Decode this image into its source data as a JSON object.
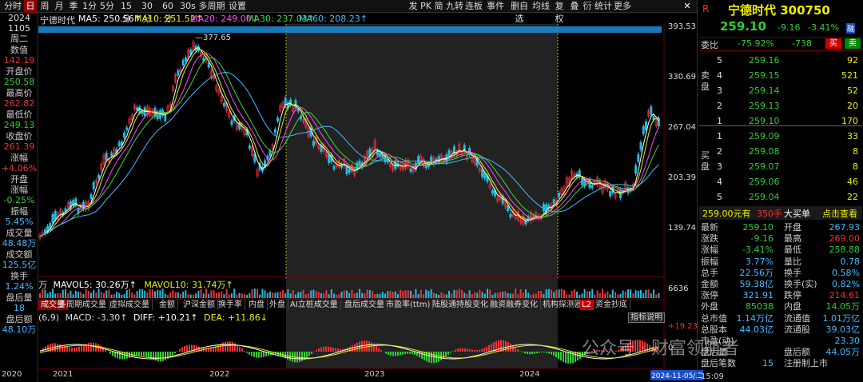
{
  "left": {
    "time_label": "时间",
    "year": "2024",
    "date": "1105",
    "weekday": "周二",
    "value_label": "数值",
    "value": "142.19",
    "open_label": "开盘价",
    "open": "250.58",
    "high_label": "最高价",
    "high": "262.82",
    "low_label": "最低价",
    "low": "249.13",
    "close_label": "收盘价",
    "close": "261.39",
    "chg_label": "涨幅",
    "chg": "+4.06%",
    "openchg_label1": "开盘",
    "openchg_label2": "涨幅",
    "openchg": "-0.25%",
    "amp_label": "振幅",
    "amp": "5.45%",
    "vol_label": "成交量",
    "vol": "48.48万",
    "amt_label": "成交额",
    "amt": "125.5亿",
    "turn_label": "换手",
    "turn": "1.24%",
    "after_label": "盘后量",
    "after": "18",
    "after_amt_label": "盘后额",
    "after_amt": "48.10万"
  },
  "toolbar": {
    "left": [
      "分时",
      "日",
      "周",
      "月",
      "季",
      "1分",
      "5分",
      "15分",
      "30分",
      "60分",
      "30s",
      "多周期",
      "设置"
    ],
    "selected": "日",
    "right": [
      "发",
      "PK",
      "简",
      "九转",
      "连板",
      "事件",
      "删自选",
      "均线",
      "复权",
      "叠",
      "衍",
      "统计",
      "更多"
    ]
  },
  "ma_legend": {
    "stock": "宁德时代",
    "ma5": "MA5: 250.56↑",
    "ma10": "MA10: 251.52↑",
    "ma20": "MA20: 249.00↓",
    "ma30": "MA30: 237.03↑",
    "ma60": "MA60: 208.23↑"
  },
  "price_axis": [
    "393.53",
    "330.69",
    "267.04",
    "203.39",
    "139.74"
  ],
  "peak_label": "377.65",
  "volume_legend": {
    "prefix": "万",
    "mavol5": "MAVOL5: 30.26万↑",
    "mavol10": "MAVOL10: 31.74万↑",
    "axis": "6636"
  },
  "ind_tabs": [
    "成交量",
    "多周期成交量",
    "虚拟成交量",
    "金额",
    "沪深金额",
    "换手率",
    "内盘",
    "外盘",
    "AI立桩成交量",
    "盘后成交量",
    "市盈率(ttm)",
    "陆股通持股变化",
    "融资融券变化",
    "机构探测器",
    "资金抄底"
  ],
  "ind_tab_badge": "L2",
  "macd": {
    "params": "(6,9)",
    "macd": "MACD: -3.30↑",
    "dif": "DIFF: +10.21↑",
    "dea": "DEA: +11.86↓",
    "axis_top": "19.23",
    "axis_zero": "0",
    "btn": "指标说明"
  },
  "years": [
    "2020",
    "2021",
    "2022",
    "2023",
    "2024"
  ],
  "cur_date": "2024-11-05/二",
  "watermark": "公众号 · 财富领航者",
  "right": {
    "name": "宁德时代",
    "code": "300750",
    "price": "259.10",
    "chg": "-9.16",
    "pct": "-3.41%",
    "tag": "融",
    "wb_label": "委比",
    "wb": "-75.92%",
    "wc": "-738",
    "buy_btn": "买",
    "sell_btn": "卖",
    "sell_side": "卖盘",
    "buy_side": "买盘",
    "asks": [
      {
        "lv": "5",
        "p": "259.16",
        "v": "92"
      },
      {
        "lv": "4",
        "p": "259.15",
        "v": "521"
      },
      {
        "lv": "3",
        "p": "259.14",
        "v": "52"
      },
      {
        "lv": "2",
        "p": "259.13",
        "v": "20"
      },
      {
        "lv": "1",
        "p": "259.10",
        "v": "170"
      }
    ],
    "bids": [
      {
        "lv": "1",
        "p": "259.09",
        "v": "33"
      },
      {
        "lv": "2",
        "p": "259.08",
        "v": "8"
      },
      {
        "lv": "3",
        "p": "259.07",
        "v": "8"
      },
      {
        "lv": "4",
        "p": "259.06",
        "v": "46"
      },
      {
        "lv": "5",
        "p": "259.04",
        "v": "22"
      }
    ],
    "bigorder": {
      "p": "259.00元有",
      "v": "350手",
      "t": "大买单",
      "link": "点击查看"
    },
    "stats": [
      [
        "最新",
        "259.10",
        "开盘",
        "267.93"
      ],
      [
        "涨跌",
        "-9.16",
        "最高",
        "269.00"
      ],
      [
        "涨幅",
        "-3.41%",
        "最低",
        "258.88"
      ],
      [
        "振幅",
        "3.77%",
        "量比",
        "0.78"
      ],
      [
        "总手",
        "22.56万",
        "换手",
        "0.58%"
      ],
      [
        "金额",
        "59.38亿",
        "换手(实)",
        "0.82%"
      ],
      [
        "涨停",
        "321.91",
        "跌停",
        "214.61"
      ],
      [
        "外盘",
        "85038",
        "内盘",
        "14.05万"
      ],
      [
        "总市值",
        "1.14万亿",
        "流通值",
        "1.01万亿"
      ],
      [
        "总股本",
        "44.03亿",
        "流通股",
        "39.03亿"
      ],
      [
        "市盈(动)",
        "",
        "",
        "23.30"
      ],
      [
        "盘后量",
        "",
        "盘后额",
        "44.05万"
      ],
      [
        "盘后笔数",
        "15",
        "注册制上市",
        ""
      ]
    ],
    "time": "15:09"
  }
}
